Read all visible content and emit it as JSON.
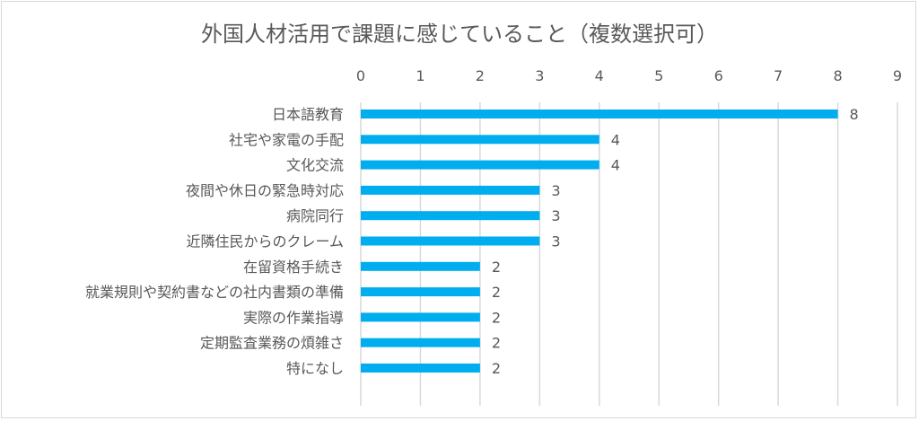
{
  "chart_data": {
    "type": "bar",
    "orientation": "horizontal",
    "title": "外国人材活用で課題に感じていること（複数選択可）",
    "xlabel": "",
    "ylabel": "",
    "xlim": [
      0,
      9
    ],
    "x_ticks": [
      "0",
      "1",
      "2",
      "3",
      "4",
      "5",
      "6",
      "7",
      "8",
      "9"
    ],
    "x_axis_position": "top",
    "grid": true,
    "categories": [
      "日本語教育",
      "社宅や家電の手配",
      "文化交流",
      "夜間や休日の緊急時対応",
      "病院同行",
      "近隣住民からのクレーム",
      "在留資格手続き",
      "就業規則や契約書などの社内書類の準備",
      "実際の作業指導",
      "定期監査業務の煩雑さ",
      "特になし"
    ],
    "values": [
      8,
      4,
      4,
      3,
      3,
      3,
      2,
      2,
      2,
      2,
      2
    ],
    "data_labels": [
      "8",
      "4",
      "4",
      "3",
      "3",
      "3",
      "2",
      "2",
      "2",
      "2",
      "2"
    ],
    "colors": {
      "bar": "#00aeef",
      "grid": "#d9d9d9",
      "text": "#595959"
    }
  }
}
